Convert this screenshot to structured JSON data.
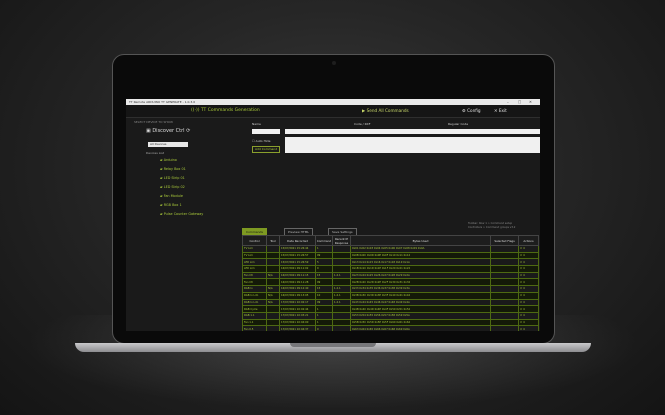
{
  "app": {
    "window_title": "TT Remote ARDUINO TT GENERATE - 1.0.3.0",
    "brand": "TT Commands Generation",
    "send_all": "Send All Commands",
    "config": "Config",
    "exit": "Exit"
  },
  "sidebar": {
    "subtitle": "SELECT DEVICE TO SHOW",
    "controller": "Discover Ctrl",
    "device_select": "All Devices",
    "group_label": "Devices List",
    "devices": [
      "Arduino",
      "Relay Box 01",
      "LED Strip 01",
      "LED Strip 02",
      "Fan Module",
      "RGB Box 1",
      "Pulse Counter Gateway"
    ]
  },
  "form": {
    "name_label": "Name",
    "code_label": "Code / RXF",
    "regular_label": "Regular Code",
    "checkbox_label": "Auto Hide",
    "add_button": "Add Command"
  },
  "tabs": [
    "Commands",
    "Preview HTML",
    "Save Settings"
  ],
  "notes": [
    "Toolbar: Row 1 > Command setup",
    "Controllers > Command groups v3.2"
  ],
  "table": {
    "headers": [
      "Control",
      "Tool",
      "Date Recorded",
      "Command",
      "Recent IP Response",
      "Bytes Used",
      "Selected Flags",
      "Actions"
    ],
    "rows": [
      [
        "TV Lim",
        "",
        "15/07/2021 15:26:44",
        "1",
        "",
        "0x01 0x02 0x03 0x04 0x05 0x06 0x07 0x08 0x09 0x0A",
        "",
        "⟳ ✕"
      ],
      [
        "TV Lim",
        "",
        "15/07/2021 15:26:57",
        "99",
        "",
        "0x0B 0x0C 0x0D 0x0E 0x0F 0x10 0x11 0x12",
        "",
        "⟳ ✕"
      ],
      [
        "LED Lim",
        "",
        "15/07/2021 15:26:59",
        "5",
        "",
        "0x13 0x14 0x15 0x16 0x17 0x18 0x19 0x1A",
        "",
        "⟳ ✕"
      ],
      [
        "LED Lim",
        "",
        "16/07/2021 09:11:02",
        "0",
        "",
        "0x1B 0x1C 0x1D 0x1E 0x1F 0x20 0x21 0x22",
        "",
        "⟳ ✕"
      ],
      [
        "Fan Ctl",
        "N/A",
        "16/07/2021 09:11:15",
        "15",
        "1.2.1",
        "0x23 0x24 0x25 0x26 0x27 0x28 0x29 0x2A",
        "",
        "⟳ ✕"
      ],
      [
        "Fan Ctl",
        "",
        "16/07/2021 09:11:28",
        "99",
        "",
        "0x2B 0x2C 0x2D 0x2E 0x2F 0x30 0x31 0x32",
        "",
        "⟳ ✕"
      ],
      [
        "RGB lo",
        "N/A",
        "16/07/2021 09:12:40",
        "15",
        "1.2.1",
        "0x33 0x34 0x35 0x36 0x37 0x38 0x39 0x3A",
        "",
        "⟳ ✕"
      ],
      [
        "RGB lo Lim",
        "N/A",
        "16/07/2021 09:13:05",
        "10",
        "1.2.1",
        "0x3B 0x3C 0x3D 0x3E 0x3F 0x40 0x41 0x42",
        "",
        "⟳ ✕"
      ],
      [
        "RGB lo Lim",
        "N/A",
        "17/07/2021 10:02:17",
        "99",
        "1.2.1",
        "0x43 0x44 0x45 0x46 0x47 0x48 0x49 0x4A",
        "",
        "⟳ ✕"
      ],
      [
        "RGB Cycle",
        "",
        "17/07/2021 10:02:44",
        "1",
        "",
        "0x4B 0x4C 0x4D 0x4E 0x4F 0x50 0x51 0x52",
        "",
        "⟳ ✕"
      ],
      [
        "RGB 1.1",
        "",
        "17/07/2021 10:03:21",
        "1",
        "",
        "0x53 0x54 0x55 0x56 0x57 0x58 0x59 0x5A",
        "",
        "⟳ ✕"
      ],
      [
        "Fan 1.1",
        "",
        "17/07/2021 10:04:00",
        "1",
        "",
        "0x5B 0x5C 0x5D 0x5E 0x5F 0x60 0x61 0x62",
        "",
        "⟳ ✕"
      ],
      [
        "Fan 0.5",
        "",
        "17/07/2021 10:04:37",
        "0",
        "",
        "0x63 0x64 0x65 0x66 0x67 0x68 0x69 0x6A",
        "",
        "⟳ ✕"
      ],
      [
        "Fan 1.1",
        "N/A",
        "18/07/2021 11:20:09",
        "5",
        "1.2.1",
        "0x6B 0x6C 0x6D 0x6E 0x6F 0x70 0x71 0x72",
        "—",
        "⟳ ✕"
      ],
      [
        "Pressure Gate Off",
        "",
        "18/07/2021 11:20:52",
        "1",
        "",
        "0x73 0x74 0x75 0x76 0x77 0x78 0x79 0x7A",
        "",
        "⟳ ✕"
      ],
      [
        "Switch Gate Half",
        "N/A",
        "18/07/2021 11:21:30",
        "10",
        "1.2.1",
        "0x7B 0x7C 0x7D 0x7E 0x7F 0x80 0x81 0x82",
        "",
        "⟳ ✕"
      ],
      [
        "Counter Gateway",
        "N/A",
        "18/07/2021 11:22:11",
        "15",
        "1.2.1",
        "0x83 0x84 0x85 0x86 0x87 0x88 0x89 0x8A",
        "",
        "⟳ ✕"
      ]
    ]
  }
}
